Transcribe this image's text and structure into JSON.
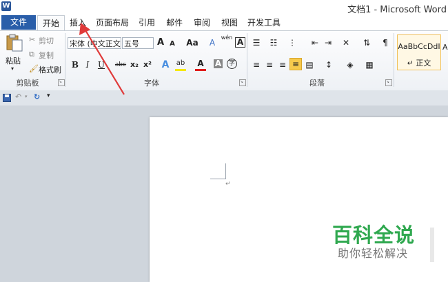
{
  "window": {
    "title": "文档1 - Microsoft Word",
    "app_icon": "W"
  },
  "tabs": {
    "file": "文件",
    "items": [
      "开始",
      "插入",
      "页面布局",
      "引用",
      "邮件",
      "审阅",
      "视图",
      "开发工具"
    ]
  },
  "clipboard": {
    "paste": "粘贴",
    "cut": "剪切",
    "copy": "复制",
    "format_painter": "格式刷",
    "group_label": "剪贴板"
  },
  "font": {
    "font_name": "宋体 (中文正文)",
    "font_size": "五号",
    "bold": "B",
    "italic": "I",
    "underline": "U",
    "strikethrough": "abc",
    "subscript": "x₂",
    "superscript": "x²",
    "grow": "A",
    "shrink": "A",
    "change_case": "Aa",
    "clear_format": "A",
    "phonetic": "wén",
    "char_border": "A",
    "text_effect": "A",
    "highlight": "ab",
    "font_color": "A",
    "char_shading": "A",
    "enclose": "字",
    "group_label": "字体"
  },
  "paragraph": {
    "group_label": "段落"
  },
  "styles": {
    "preview": "AaBbCcDdI",
    "normal": "↵ 正文",
    "next_preview": "A"
  },
  "document": {
    "paragraph_mark": "↵"
  },
  "watermark": {
    "title": "百科全说",
    "subtitle": "助你轻松解决"
  },
  "colors": {
    "file_tab": "#2a5ea9",
    "highlight": "#f5e800",
    "font_color": "#e01b1b",
    "watermark": "#2fa84f",
    "arrow": "#e03a3a"
  }
}
